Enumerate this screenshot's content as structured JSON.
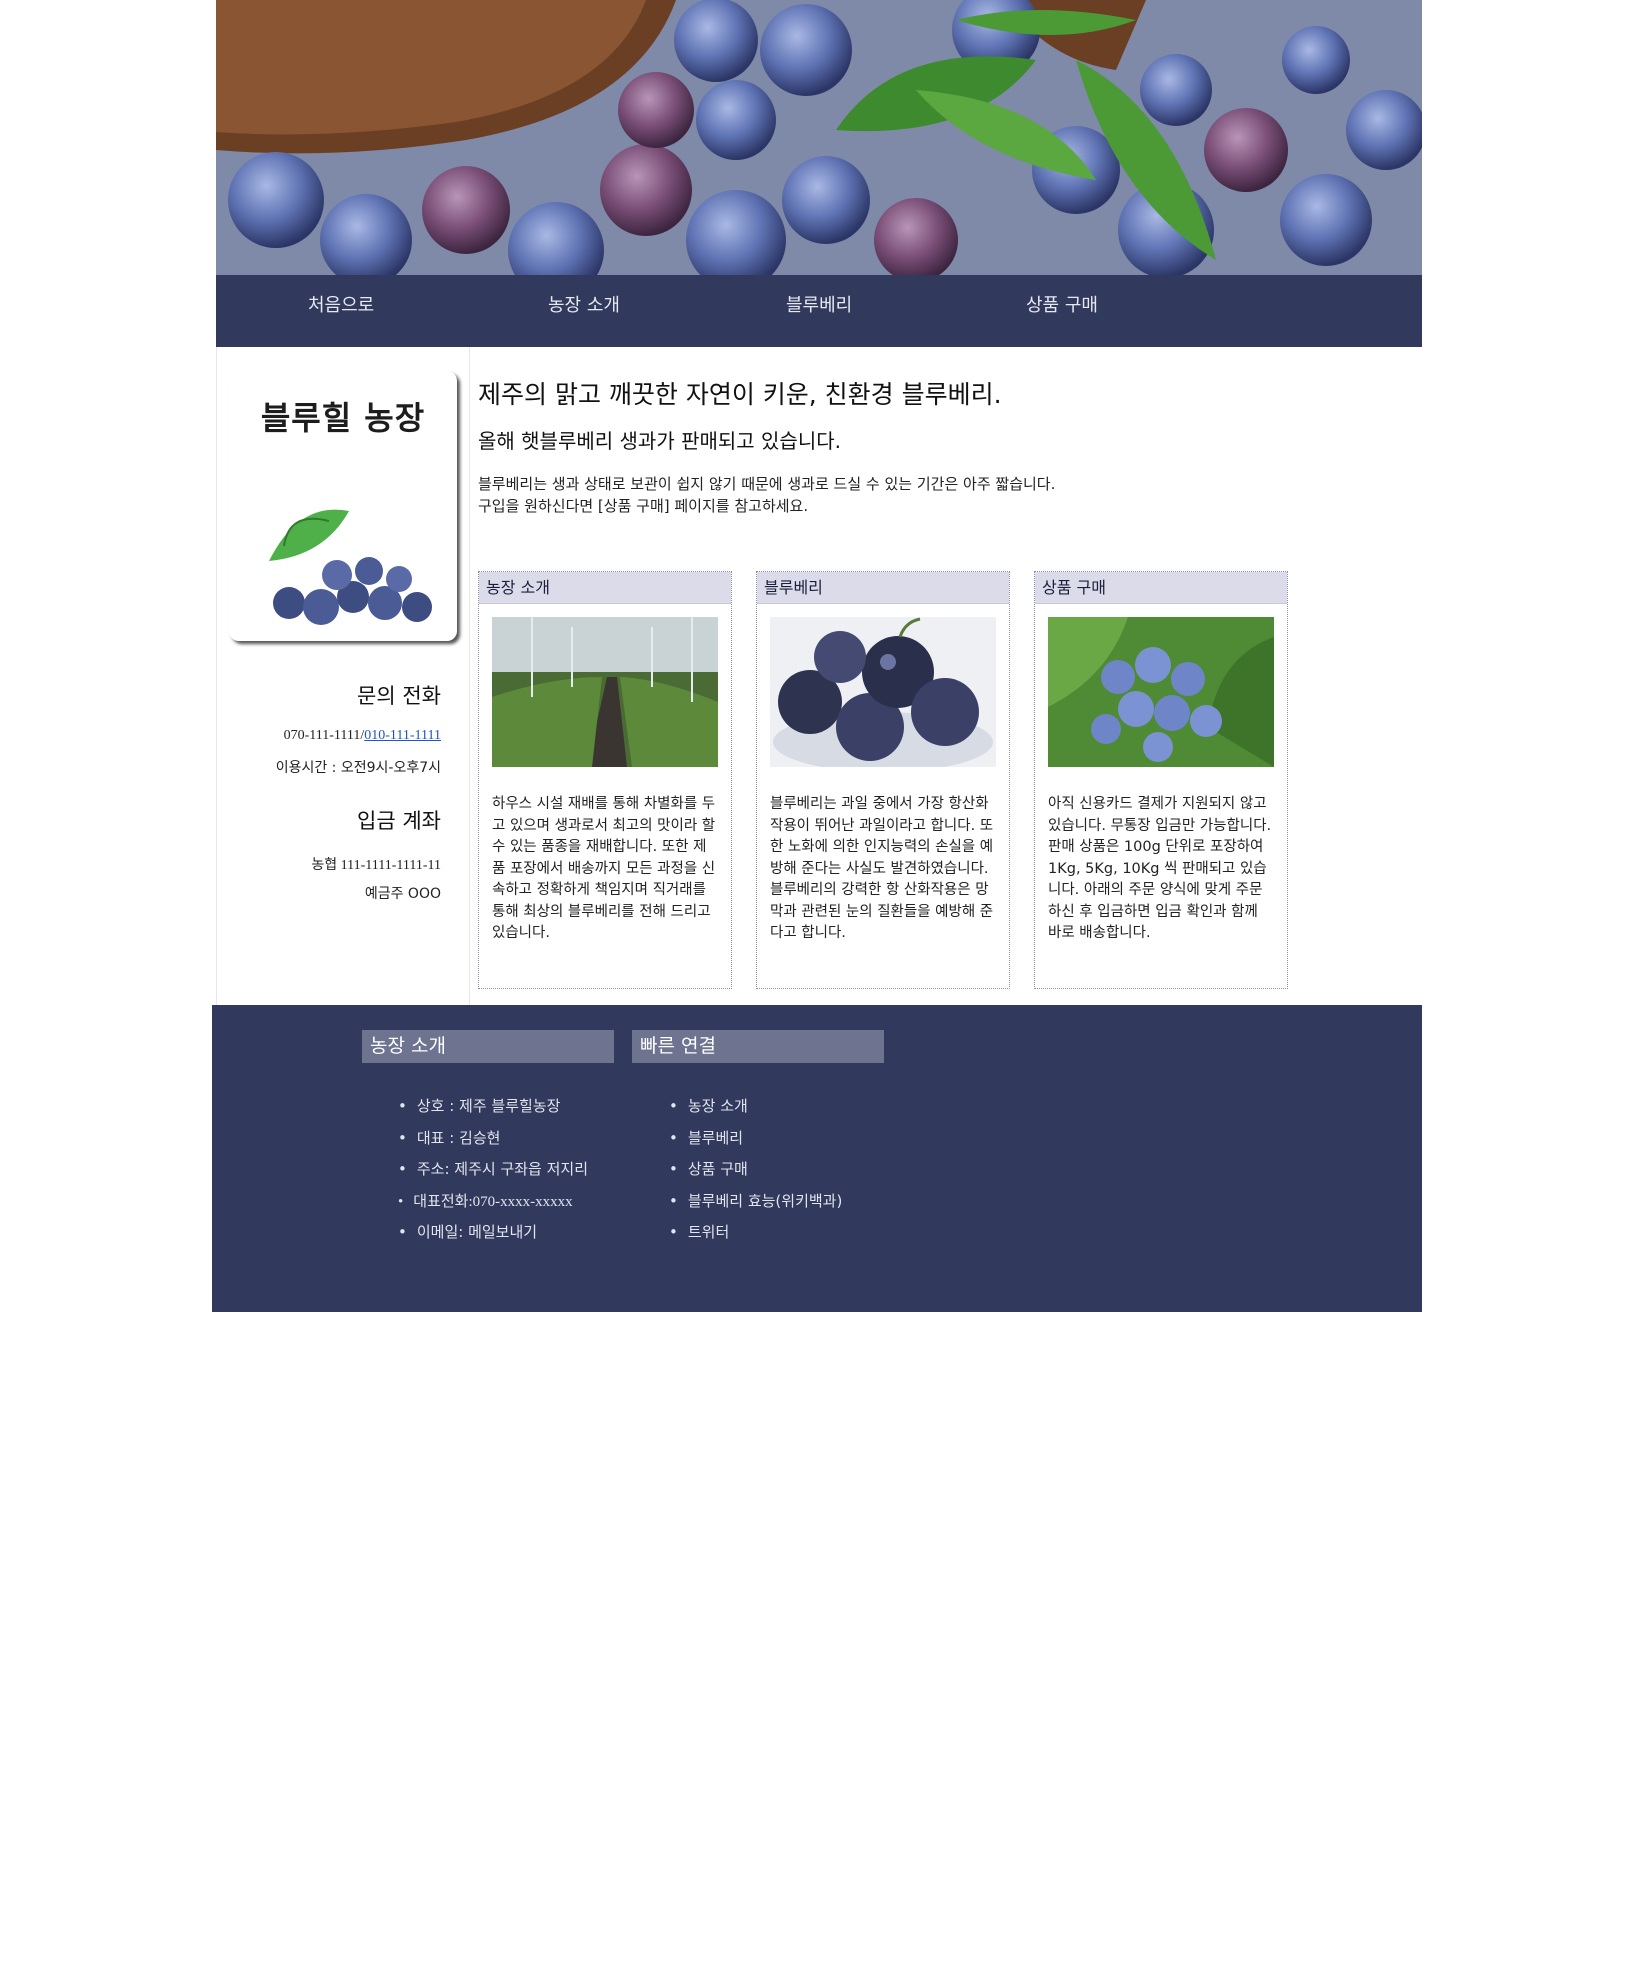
{
  "nav": {
    "items": [
      "처음으로",
      "농장 소개",
      "블루베리",
      "상품 구매"
    ]
  },
  "sidebar": {
    "logo_title": "블루힐 농장",
    "contact_heading": "문의 전화",
    "phone1": "070-111-1111/",
    "phone2": "010-111-1111",
    "hours": "이용시간 : 오전9시-오후7시",
    "account_heading": "입금 계좌",
    "account": "농협 111-1111-1111-11",
    "holder": "예금주 OOO"
  },
  "main": {
    "headline": "제주의 맑고 깨끗한 자연이 키운, 친환경 블루베리.",
    "subheadline": "올해 햇블루베리 생과가 판매되고 있습니다.",
    "paragraph_line1": "블루베리는 생과 상태로 보관이 쉽지 않기 때문에 생과로 드실 수 있는 기간은 아주 짧습니다.",
    "paragraph_line2": "구입을 원하신다면 [상품 구매] 페이지를 참고하세요."
  },
  "cards": [
    {
      "title": "농장 소개",
      "text": "하우스 시설 재배를 통해 차별화를 두고 있으며 생과로서 최고의 맛이라 할 수 있는 품종을 재배합니다. 또한 제품 포장에서 배송까지 모든 과정을 신속하고 정확하게 책임지며 직거래를 통해 최상의 블루베리를 전해 드리고 있습니다."
    },
    {
      "title": "블루베리",
      "text": "블루베리는 과일 중에서 가장 항산화 작용이 뛰어난 과일이라고 합니다. 또한 노화에 의한 인지능력의 손실을 예방해 준다는 사실도 발견하였습니다. 블루베리의 강력한 항 산화작용은 망막과 관련된 눈의 질환들을 예방해 준다고 합니다."
    },
    {
      "title": "상품 구매",
      "text": "아직 신용카드 결제가 지원되지 않고 있습니다. 무통장 입금만 가능합니다. 판매 상품은 100g 단위로 포장하여 1Kg, 5Kg, 10Kg 씩 판매되고 있습니다. 아래의 주문 양식에 맞게 주문하신 후 입금하면 입금 확인과 함께 바로 배송합니다."
    }
  ],
  "footer": {
    "farm_heading": "농장 소개",
    "farm_items": [
      "상호 : 제주 블루힐농장",
      "대표 : 김승현",
      "주소: 제주시 구좌읍 저지리",
      "대표전화:070-xxxx-xxxxx",
      "이메일: 메일보내기"
    ],
    "links_heading": "빠른 연결",
    "link_items": [
      "농장 소개",
      "블루베리",
      "상품 구매",
      "블루베리 효능(위키백과)",
      "트위터"
    ]
  },
  "colors": {
    "nav_bg": "#31395c",
    "footer_bg": "#31395c",
    "footer_heading_bg": "#6e7390",
    "card_header_bg": "#dcdbea",
    "link": "#1f55c9"
  }
}
